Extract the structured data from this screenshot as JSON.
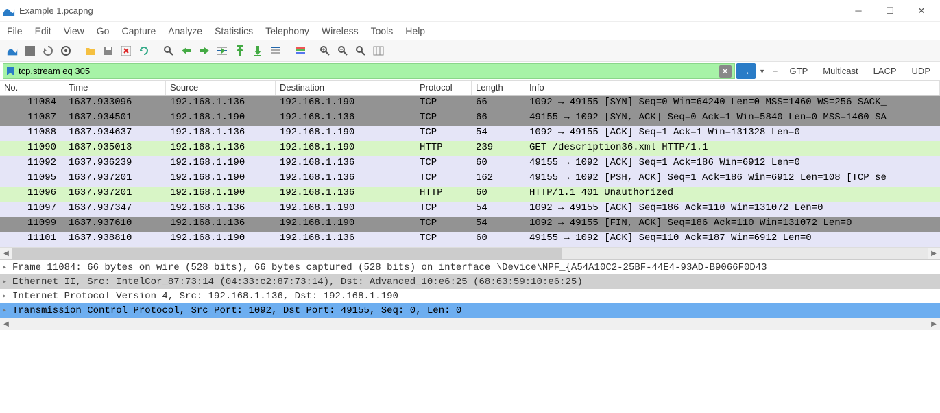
{
  "window": {
    "title": "Example 1.pcapng"
  },
  "menu": [
    "File",
    "Edit",
    "View",
    "Go",
    "Capture",
    "Analyze",
    "Statistics",
    "Telephony",
    "Wireless",
    "Tools",
    "Help"
  ],
  "filter": {
    "value": "tcp.stream eq 305",
    "quick_labels": [
      "GTP",
      "Multicast",
      "LACP",
      "UDP"
    ]
  },
  "columns": {
    "no": "No.",
    "time": "Time",
    "source": "Source",
    "destination": "Destination",
    "protocol": "Protocol",
    "length": "Length",
    "info": "Info"
  },
  "packets": [
    {
      "no": "11084",
      "time": "1637.933096",
      "src": "192.168.1.136",
      "dst": "192.168.1.190",
      "proto": "TCP",
      "len": "66",
      "info": "1092 → 49155 [SYN] Seq=0 Win=64240 Len=0 MSS=1460 WS=256 SACK_",
      "style": "gray"
    },
    {
      "no": "11087",
      "time": "1637.934501",
      "src": "192.168.1.190",
      "dst": "192.168.1.136",
      "proto": "TCP",
      "len": "66",
      "info": "49155 → 1092 [SYN, ACK] Seq=0 Ack=1 Win=5840 Len=0 MSS=1460 SA",
      "style": "gray"
    },
    {
      "no": "11088",
      "time": "1637.934637",
      "src": "192.168.1.136",
      "dst": "192.168.1.190",
      "proto": "TCP",
      "len": "54",
      "info": "1092 → 49155 [ACK] Seq=1 Ack=1 Win=131328 Len=0",
      "style": "lav"
    },
    {
      "no": "11090",
      "time": "1637.935013",
      "src": "192.168.1.136",
      "dst": "192.168.1.190",
      "proto": "HTTP",
      "len": "239",
      "info": "GET /description36.xml HTTP/1.1",
      "style": "green"
    },
    {
      "no": "11092",
      "time": "1637.936239",
      "src": "192.168.1.190",
      "dst": "192.168.1.136",
      "proto": "TCP",
      "len": "60",
      "info": "49155 → 1092 [ACK] Seq=1 Ack=186 Win=6912 Len=0",
      "style": "lav"
    },
    {
      "no": "11095",
      "time": "1637.937201",
      "src": "192.168.1.190",
      "dst": "192.168.1.136",
      "proto": "TCP",
      "len": "162",
      "info": "49155 → 1092 [PSH, ACK] Seq=1 Ack=186 Win=6912 Len=108 [TCP se",
      "style": "lav"
    },
    {
      "no": "11096",
      "time": "1637.937201",
      "src": "192.168.1.190",
      "dst": "192.168.1.136",
      "proto": "HTTP",
      "len": "60",
      "info": "HTTP/1.1 401 Unauthorized",
      "style": "green"
    },
    {
      "no": "11097",
      "time": "1637.937347",
      "src": "192.168.1.136",
      "dst": "192.168.1.190",
      "proto": "TCP",
      "len": "54",
      "info": "1092 → 49155 [ACK] Seq=186 Ack=110 Win=131072 Len=0",
      "style": "lav"
    },
    {
      "no": "11099",
      "time": "1637.937610",
      "src": "192.168.1.136",
      "dst": "192.168.1.190",
      "proto": "TCP",
      "len": "54",
      "info": "1092 → 49155 [FIN, ACK] Seq=186 Ack=110 Win=131072 Len=0",
      "style": "gray"
    },
    {
      "no": "11101",
      "time": "1637.938810",
      "src": "192.168.1.190",
      "dst": "192.168.1.136",
      "proto": "TCP",
      "len": "60",
      "info": "49155 → 1092 [ACK] Seq=110 Ack=187 Win=6912 Len=0",
      "style": "lav"
    }
  ],
  "details": [
    {
      "text": "Frame 11084: 66 bytes on wire (528 bits), 66 bytes captured (528 bits) on interface \\Device\\NPF_{A54A10C2-25BF-44E4-93AD-B9066F0D43",
      "style": "normal"
    },
    {
      "text": "Ethernet II, Src: IntelCor_87:73:14 (04:33:c2:87:73:14), Dst: Advanced_10:e6:25 (68:63:59:10:e6:25)",
      "style": "gray"
    },
    {
      "text": "Internet Protocol Version 4, Src: 192.168.1.136, Dst: 192.168.1.190",
      "style": "normal"
    },
    {
      "text": "Transmission Control Protocol, Src Port: 1092, Dst Port: 49155, Seq: 0, Len: 0",
      "style": "blue"
    }
  ]
}
